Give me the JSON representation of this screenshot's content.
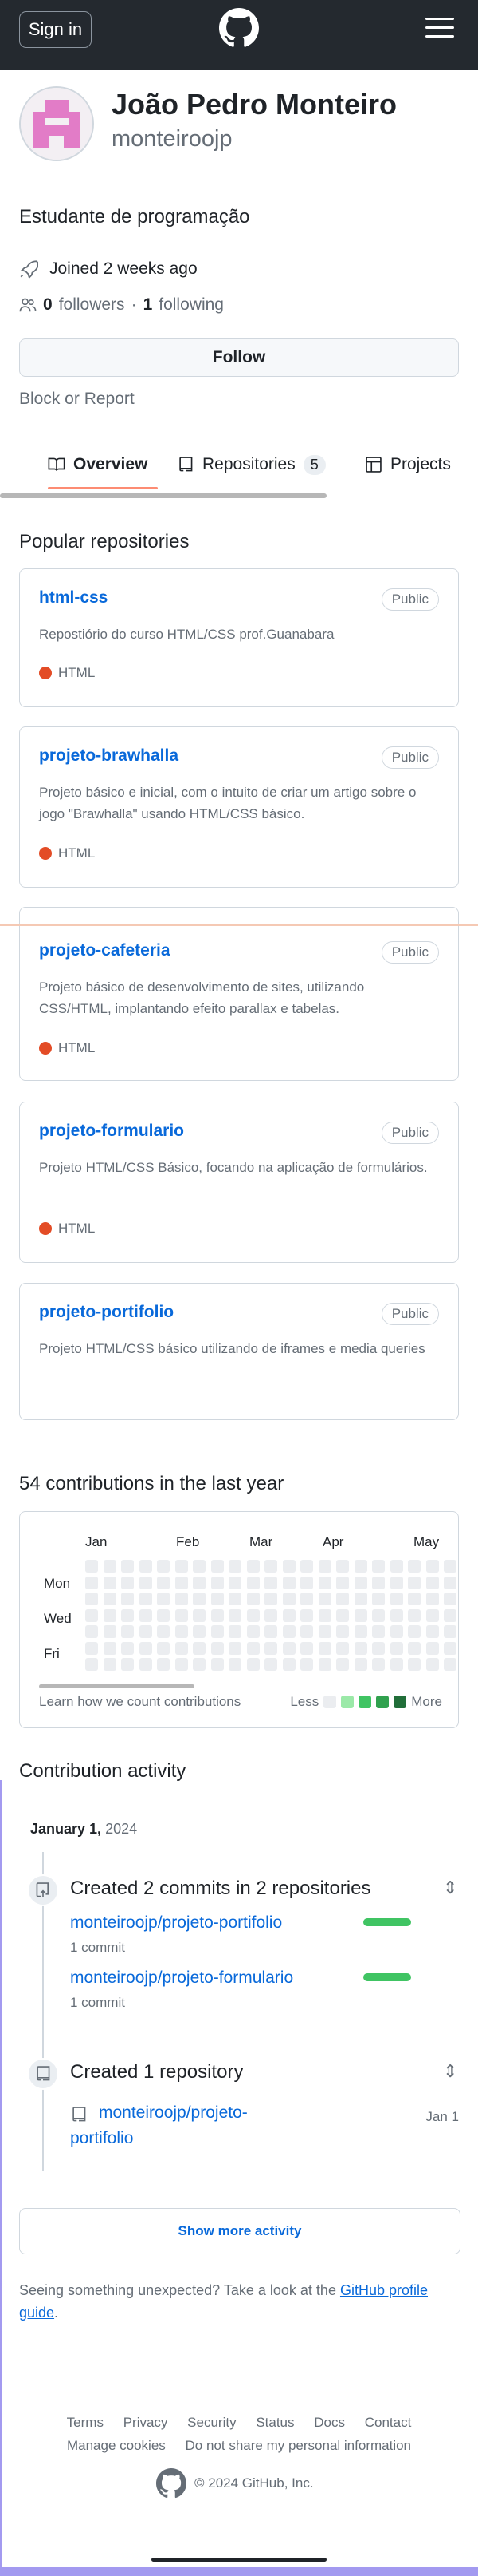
{
  "header": {
    "signin_label": "Sign in",
    "logo_icon": "github-mark-icon",
    "menu_icon": "hamburger-icon"
  },
  "profile": {
    "name": "João Pedro Monteiro",
    "login": "monteiroojp",
    "bio": "Estudante de programação",
    "joined": "Joined 2 weeks ago",
    "followers_count": "0",
    "followers_label": "followers",
    "separator": "·",
    "following_count": "1",
    "following_label": "following",
    "follow_button": "Follow",
    "block_report": "Block or Report"
  },
  "tabs": [
    {
      "label": "Overview",
      "icon": "book-icon",
      "active": true
    },
    {
      "label": "Repositories",
      "icon": "repo-icon",
      "count": "5"
    },
    {
      "label": "Projects",
      "icon": "table-icon"
    }
  ],
  "popular": {
    "title": "Popular repositories",
    "repos": [
      {
        "name": "html-css",
        "visibility": "Public",
        "description": "Repostiório do curso HTML/CSS prof.Guanabara",
        "language": "HTML"
      },
      {
        "name": "projeto-brawhalla",
        "visibility": "Public",
        "description": "Projeto básico e inicial, com o intuito de criar um artigo sobre o jogo \"Brawhalla\" usando HTML/CSS básico.",
        "language": "HTML"
      },
      {
        "name": "projeto-cafeteria",
        "visibility": "Public",
        "description": "Projeto básico de desenvolvimento de sites, utilizando CSS/HTML, implantando efeito parallax e tabelas.",
        "language": "HTML"
      },
      {
        "name": "projeto-formulario",
        "visibility": "Public",
        "description": "Projeto HTML/CSS Básico, focando na aplicação de formulários.",
        "language": "HTML"
      },
      {
        "name": "projeto-portifolio",
        "visibility": "Public",
        "description": "Projeto HTML/CSS básico utilizando de iframes e media queries",
        "language": ""
      }
    ],
    "language_color": "#e34c26"
  },
  "contributions": {
    "title": "54 contributions in the last year",
    "months": [
      "Jan",
      "Feb",
      "Mar",
      "Apr",
      "May"
    ],
    "days": [
      "Mon",
      "Wed",
      "Fri"
    ],
    "learn_link": "Learn how we count contributions",
    "legend_less": "Less",
    "legend_more": "More",
    "legend_colors": [
      "#ebedf0",
      "#9be9a8",
      "#40c463",
      "#30a14e",
      "#216e39"
    ]
  },
  "activity": {
    "title": "Contribution activity",
    "month_label": "January 1,",
    "month_year": "2024",
    "commits_title": "Created 2 commits in 2 repositories",
    "commit_items": [
      {
        "repo": "monteiroojp/projeto-portifolio",
        "count": "1 commit"
      },
      {
        "repo": "monteiroojp/projeto-formulario",
        "count": "1 commit"
      }
    ],
    "repo_title": "Created 1 repository",
    "created_repo_line1": "monteiroojp/projeto-",
    "created_repo_line2": "portifolio",
    "created_date": "Jan 1",
    "show_more": "Show more activity",
    "unexpected_text": "Seeing something unexpected? Take a look at the ",
    "unexpected_link": "GitHub profile guide",
    "unexpected_end": "."
  },
  "footer": {
    "links_row1": [
      "Terms",
      "Privacy",
      "Security",
      "Status",
      "Docs",
      "Contact"
    ],
    "links_row2": [
      "Manage cookies",
      "Do not share my personal information"
    ],
    "copyright": "© 2024 GitHub, Inc."
  }
}
